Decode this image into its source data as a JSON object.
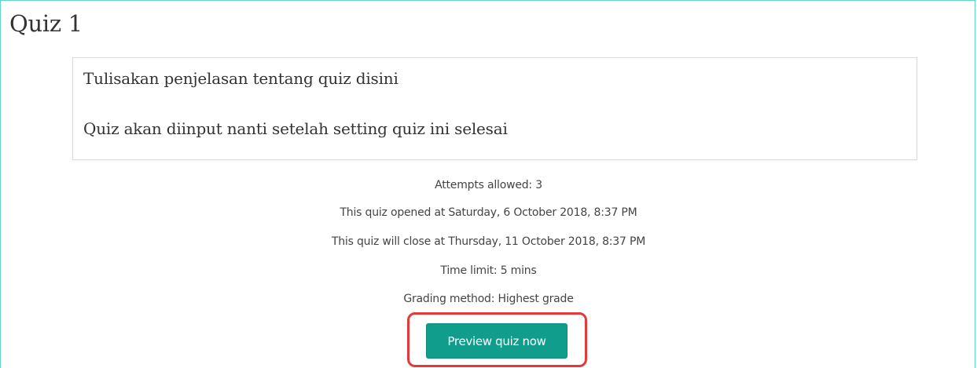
{
  "page": {
    "title": "Quiz 1"
  },
  "intro": {
    "lines": [
      "Tulisakan penjelasan tentang quiz disini",
      "Quiz akan diinput nanti setelah setting quiz ini selesai"
    ]
  },
  "info": {
    "attempts": "Attempts allowed: 3",
    "opened": "This quiz opened at Saturday, 6 October 2018, 8:37 PM",
    "closes": "This quiz will close at Thursday, 11 October 2018, 8:37 PM",
    "time_limit": "Time limit: 5 mins",
    "grading": "Grading method: Highest grade"
  },
  "actions": {
    "preview_label": "Preview quiz now"
  },
  "colors": {
    "button": "#119d8c",
    "highlight": "#e23a3a",
    "frame": "#5fd6cc"
  }
}
